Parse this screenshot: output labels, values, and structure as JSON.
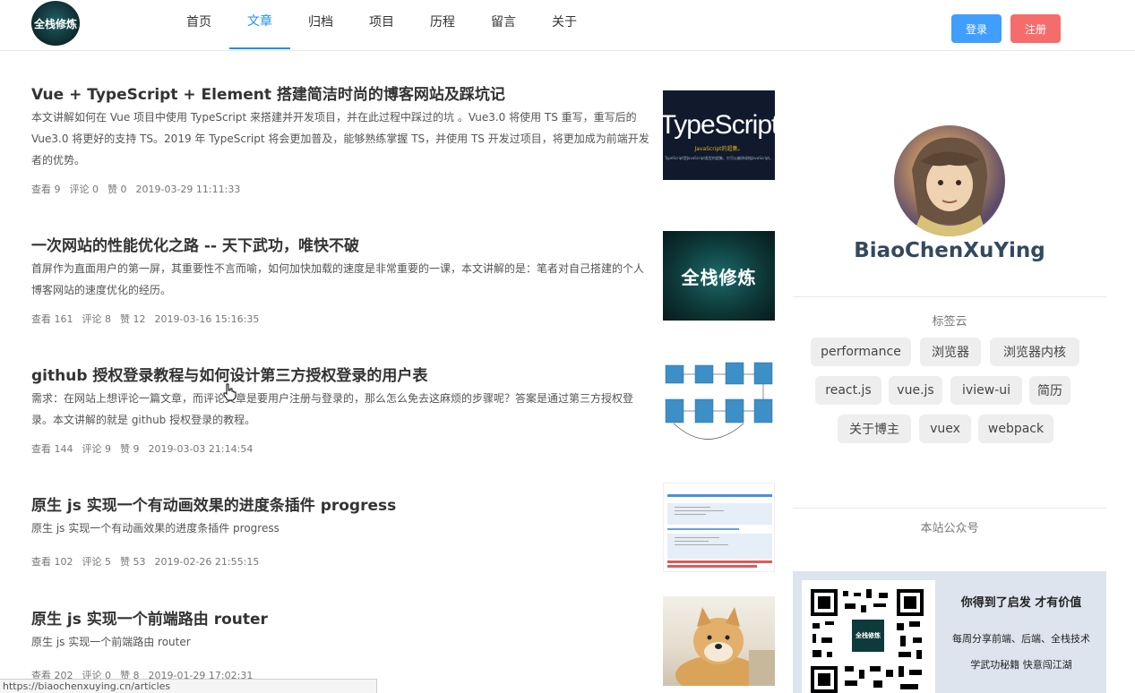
{
  "header": {
    "logo_text": "全栈修炼",
    "nav": [
      "首页",
      "文章",
      "归档",
      "项目",
      "历程",
      "留言",
      "关于"
    ],
    "active_nav": "文章",
    "login_label": "登录",
    "register_label": "注册"
  },
  "articles": [
    {
      "title": "Vue + TypeScript + Element 搭建简洁时尚的博客网站及踩坑记",
      "desc": "本文讲解如何在 Vue 项目中使用 TypeScript 来搭建并开发项目，并在此过程中踩过的坑 。Vue3.0 将使用 TS 重写，重写后的 Vue3.0 将更好的支持 TS。2019 年 TypeScript 将会更加普及，能够熟练掌握 TS，并使用 TS 开发过项目，将更加成为前端开发者的优势。",
      "views": "查看 9",
      "comments": "评论 0",
      "likes": "赞 0",
      "date": "2019-03-29 11:11:33",
      "thumb": {
        "kind": "typescript",
        "big": "TypeScript",
        "sub": "JavaScript的超集。",
        "sub2": "TypeScript是JavaScript类型的超集，它可以编译成纯JavaScript。"
      }
    },
    {
      "title": "一次网站的性能优化之路 -- 天下武功，唯快不破",
      "desc": "首屏作为直面用户的第一屏，其重要性不言而喻，如何加快加载的速度是非常重要的一课，本文讲解的是：笔者对自己搭建的个人博客网站的速度优化的经历。",
      "views": "查看 161",
      "comments": "评论 8",
      "likes": "赞 12",
      "date": "2019-03-16 15:16:35",
      "thumb": {
        "kind": "quanzhan",
        "text": "全栈修炼"
      }
    },
    {
      "title": "github 授权登录教程与如何设计第三方授权登录的用户表",
      "desc": "需求：在网站上想评论一篇文章，而评论文章是要用户注册与登录的，那么怎么免去这麻烦的步骤呢？答案是通过第三方授权登录。本文讲解的就是 github 授权登录的教程。",
      "views": "查看 144",
      "comments": "评论 9",
      "likes": "赞 9",
      "date": "2019-03-03 21:14:54",
      "thumb": {
        "kind": "flowchart"
      }
    },
    {
      "title": "原生 js 实现一个有动画效果的进度条插件 progress",
      "desc": "原生 js 实现一个有动画效果的进度条插件 progress",
      "views": "查看 102",
      "comments": "评论 5",
      "likes": "赞 53",
      "date": "2019-02-26 21:55:15",
      "thumb": {
        "kind": "progress"
      }
    },
    {
      "title": "原生 js 实现一个前端路由 router",
      "desc": "原生 js 实现一个前端路由 router",
      "views": "查看 202",
      "comments": "评论 0",
      "likes": "赞 8",
      "date": "2019-01-29 17:02:31",
      "thumb": {
        "kind": "dog"
      }
    }
  ],
  "sidebar": {
    "username": "BiaoChenXuYing",
    "tags_title": "标签云",
    "tags": [
      "performance",
      "浏览器",
      "浏览器内核",
      "react.js",
      "vue.js",
      "iview-ui",
      "简历",
      "关于博主",
      "vuex",
      "webpack"
    ],
    "official_title": "本站公众号",
    "qr_logo": "全栈修炼",
    "slogan": "你得到了启发 才有价值",
    "line1": "每周分享前端、后端、全栈技术",
    "line2": "学武功秘籍 快意闯江湖"
  },
  "status_url": "https://biaochenxuying.cn/articles",
  "colors": {
    "accent": "#1890ff",
    "login": "#409eff",
    "register": "#f56c6c",
    "username": "#34495e"
  }
}
